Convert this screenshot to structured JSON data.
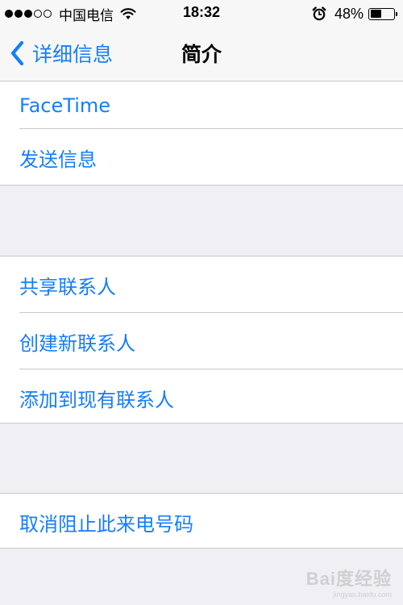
{
  "status_bar": {
    "carrier": "中国电信",
    "time": "18:32",
    "battery_percent": "48%",
    "battery_level": 0.48,
    "signal_bars_filled": 3,
    "signal_bars_total": 5
  },
  "nav_bar": {
    "back_label": "详细信息",
    "title": "简介"
  },
  "sections": [
    {
      "items": [
        "FaceTime",
        "发送信息"
      ]
    },
    {
      "items": [
        "共享联系人",
        "创建新联系人",
        "添加到现有联系人"
      ]
    },
    {
      "items": [
        "取消阻止此来电号码"
      ]
    }
  ],
  "watermark": {
    "main": "Bai度经验",
    "sub": "jingyan.baidu.com"
  },
  "colors": {
    "accent": "#157efb",
    "background": "#efeff4",
    "separator": "#c8c7cc"
  },
  "icons": [
    "wifi-icon",
    "alarm-clock-icon",
    "battery-icon",
    "chevron-left-icon"
  ]
}
